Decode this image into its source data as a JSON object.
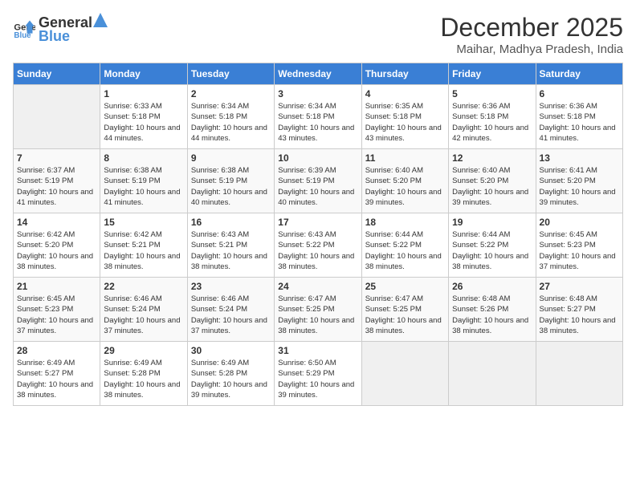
{
  "header": {
    "logo_general": "General",
    "logo_blue": "Blue",
    "title": "December 2025",
    "subtitle": "Maihar, Madhya Pradesh, India"
  },
  "days_of_week": [
    "Sunday",
    "Monday",
    "Tuesday",
    "Wednesday",
    "Thursday",
    "Friday",
    "Saturday"
  ],
  "weeks": [
    [
      {
        "day": "",
        "sunrise": "",
        "sunset": "",
        "daylight": ""
      },
      {
        "day": "1",
        "sunrise": "Sunrise: 6:33 AM",
        "sunset": "Sunset: 5:18 PM",
        "daylight": "Daylight: 10 hours and 44 minutes."
      },
      {
        "day": "2",
        "sunrise": "Sunrise: 6:34 AM",
        "sunset": "Sunset: 5:18 PM",
        "daylight": "Daylight: 10 hours and 44 minutes."
      },
      {
        "day": "3",
        "sunrise": "Sunrise: 6:34 AM",
        "sunset": "Sunset: 5:18 PM",
        "daylight": "Daylight: 10 hours and 43 minutes."
      },
      {
        "day": "4",
        "sunrise": "Sunrise: 6:35 AM",
        "sunset": "Sunset: 5:18 PM",
        "daylight": "Daylight: 10 hours and 43 minutes."
      },
      {
        "day": "5",
        "sunrise": "Sunrise: 6:36 AM",
        "sunset": "Sunset: 5:18 PM",
        "daylight": "Daylight: 10 hours and 42 minutes."
      },
      {
        "day": "6",
        "sunrise": "Sunrise: 6:36 AM",
        "sunset": "Sunset: 5:18 PM",
        "daylight": "Daylight: 10 hours and 41 minutes."
      }
    ],
    [
      {
        "day": "7",
        "sunrise": "Sunrise: 6:37 AM",
        "sunset": "Sunset: 5:19 PM",
        "daylight": "Daylight: 10 hours and 41 minutes."
      },
      {
        "day": "8",
        "sunrise": "Sunrise: 6:38 AM",
        "sunset": "Sunset: 5:19 PM",
        "daylight": "Daylight: 10 hours and 41 minutes."
      },
      {
        "day": "9",
        "sunrise": "Sunrise: 6:38 AM",
        "sunset": "Sunset: 5:19 PM",
        "daylight": "Daylight: 10 hours and 40 minutes."
      },
      {
        "day": "10",
        "sunrise": "Sunrise: 6:39 AM",
        "sunset": "Sunset: 5:19 PM",
        "daylight": "Daylight: 10 hours and 40 minutes."
      },
      {
        "day": "11",
        "sunrise": "Sunrise: 6:40 AM",
        "sunset": "Sunset: 5:20 PM",
        "daylight": "Daylight: 10 hours and 39 minutes."
      },
      {
        "day": "12",
        "sunrise": "Sunrise: 6:40 AM",
        "sunset": "Sunset: 5:20 PM",
        "daylight": "Daylight: 10 hours and 39 minutes."
      },
      {
        "day": "13",
        "sunrise": "Sunrise: 6:41 AM",
        "sunset": "Sunset: 5:20 PM",
        "daylight": "Daylight: 10 hours and 39 minutes."
      }
    ],
    [
      {
        "day": "14",
        "sunrise": "Sunrise: 6:42 AM",
        "sunset": "Sunset: 5:20 PM",
        "daylight": "Daylight: 10 hours and 38 minutes."
      },
      {
        "day": "15",
        "sunrise": "Sunrise: 6:42 AM",
        "sunset": "Sunset: 5:21 PM",
        "daylight": "Daylight: 10 hours and 38 minutes."
      },
      {
        "day": "16",
        "sunrise": "Sunrise: 6:43 AM",
        "sunset": "Sunset: 5:21 PM",
        "daylight": "Daylight: 10 hours and 38 minutes."
      },
      {
        "day": "17",
        "sunrise": "Sunrise: 6:43 AM",
        "sunset": "Sunset: 5:22 PM",
        "daylight": "Daylight: 10 hours and 38 minutes."
      },
      {
        "day": "18",
        "sunrise": "Sunrise: 6:44 AM",
        "sunset": "Sunset: 5:22 PM",
        "daylight": "Daylight: 10 hours and 38 minutes."
      },
      {
        "day": "19",
        "sunrise": "Sunrise: 6:44 AM",
        "sunset": "Sunset: 5:22 PM",
        "daylight": "Daylight: 10 hours and 38 minutes."
      },
      {
        "day": "20",
        "sunrise": "Sunrise: 6:45 AM",
        "sunset": "Sunset: 5:23 PM",
        "daylight": "Daylight: 10 hours and 37 minutes."
      }
    ],
    [
      {
        "day": "21",
        "sunrise": "Sunrise: 6:45 AM",
        "sunset": "Sunset: 5:23 PM",
        "daylight": "Daylight: 10 hours and 37 minutes."
      },
      {
        "day": "22",
        "sunrise": "Sunrise: 6:46 AM",
        "sunset": "Sunset: 5:24 PM",
        "daylight": "Daylight: 10 hours and 37 minutes."
      },
      {
        "day": "23",
        "sunrise": "Sunrise: 6:46 AM",
        "sunset": "Sunset: 5:24 PM",
        "daylight": "Daylight: 10 hours and 37 minutes."
      },
      {
        "day": "24",
        "sunrise": "Sunrise: 6:47 AM",
        "sunset": "Sunset: 5:25 PM",
        "daylight": "Daylight: 10 hours and 38 minutes."
      },
      {
        "day": "25",
        "sunrise": "Sunrise: 6:47 AM",
        "sunset": "Sunset: 5:25 PM",
        "daylight": "Daylight: 10 hours and 38 minutes."
      },
      {
        "day": "26",
        "sunrise": "Sunrise: 6:48 AM",
        "sunset": "Sunset: 5:26 PM",
        "daylight": "Daylight: 10 hours and 38 minutes."
      },
      {
        "day": "27",
        "sunrise": "Sunrise: 6:48 AM",
        "sunset": "Sunset: 5:27 PM",
        "daylight": "Daylight: 10 hours and 38 minutes."
      }
    ],
    [
      {
        "day": "28",
        "sunrise": "Sunrise: 6:49 AM",
        "sunset": "Sunset: 5:27 PM",
        "daylight": "Daylight: 10 hours and 38 minutes."
      },
      {
        "day": "29",
        "sunrise": "Sunrise: 6:49 AM",
        "sunset": "Sunset: 5:28 PM",
        "daylight": "Daylight: 10 hours and 38 minutes."
      },
      {
        "day": "30",
        "sunrise": "Sunrise: 6:49 AM",
        "sunset": "Sunset: 5:28 PM",
        "daylight": "Daylight: 10 hours and 39 minutes."
      },
      {
        "day": "31",
        "sunrise": "Sunrise: 6:50 AM",
        "sunset": "Sunset: 5:29 PM",
        "daylight": "Daylight: 10 hours and 39 minutes."
      },
      {
        "day": "",
        "sunrise": "",
        "sunset": "",
        "daylight": ""
      },
      {
        "day": "",
        "sunrise": "",
        "sunset": "",
        "daylight": ""
      },
      {
        "day": "",
        "sunrise": "",
        "sunset": "",
        "daylight": ""
      }
    ]
  ]
}
